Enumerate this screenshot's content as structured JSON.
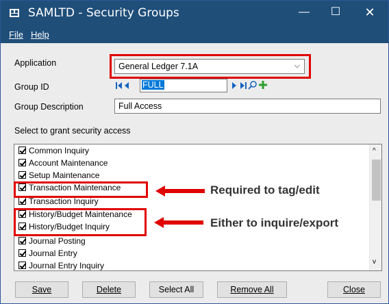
{
  "window": {
    "title": "SAMLTD - Security Groups"
  },
  "menu": {
    "file": "File",
    "help": "Help"
  },
  "form": {
    "application_label": "Application",
    "application_value": "General Ledger 7.1A",
    "group_id_label": "Group ID",
    "group_id_value": "FULL",
    "group_desc_label": "Group Description",
    "group_desc_value": "Full Access",
    "list_caption": "Select to grant security access"
  },
  "permissions": [
    {
      "label": "Common Inquiry",
      "checked": true
    },
    {
      "label": "Account Maintenance",
      "checked": true
    },
    {
      "label": "Setup Maintenance",
      "checked": true
    },
    {
      "label": "Transaction Maintenance",
      "checked": true
    },
    {
      "label": "Transaction Inquiry",
      "checked": true
    },
    {
      "label": "History/Budget Maintenance",
      "checked": true
    },
    {
      "label": "History/Budget Inquiry",
      "checked": true
    },
    {
      "label": "Journal Posting",
      "checked": true
    },
    {
      "label": "Journal Entry",
      "checked": true
    },
    {
      "label": "Journal Entry Inquiry",
      "checked": true
    }
  ],
  "annotations": {
    "required": "Required to tag/edit",
    "either": "Either to inquire/export"
  },
  "buttons": {
    "save": "Save",
    "delete": "Delete",
    "select_all": "Select All",
    "remove_all": "Remove All",
    "close": "Close"
  },
  "colors": {
    "titlebar": "#1f4e79",
    "highlight": "#e00000",
    "nav_blue": "#1565c0",
    "add_green": "#2e9e2e"
  }
}
